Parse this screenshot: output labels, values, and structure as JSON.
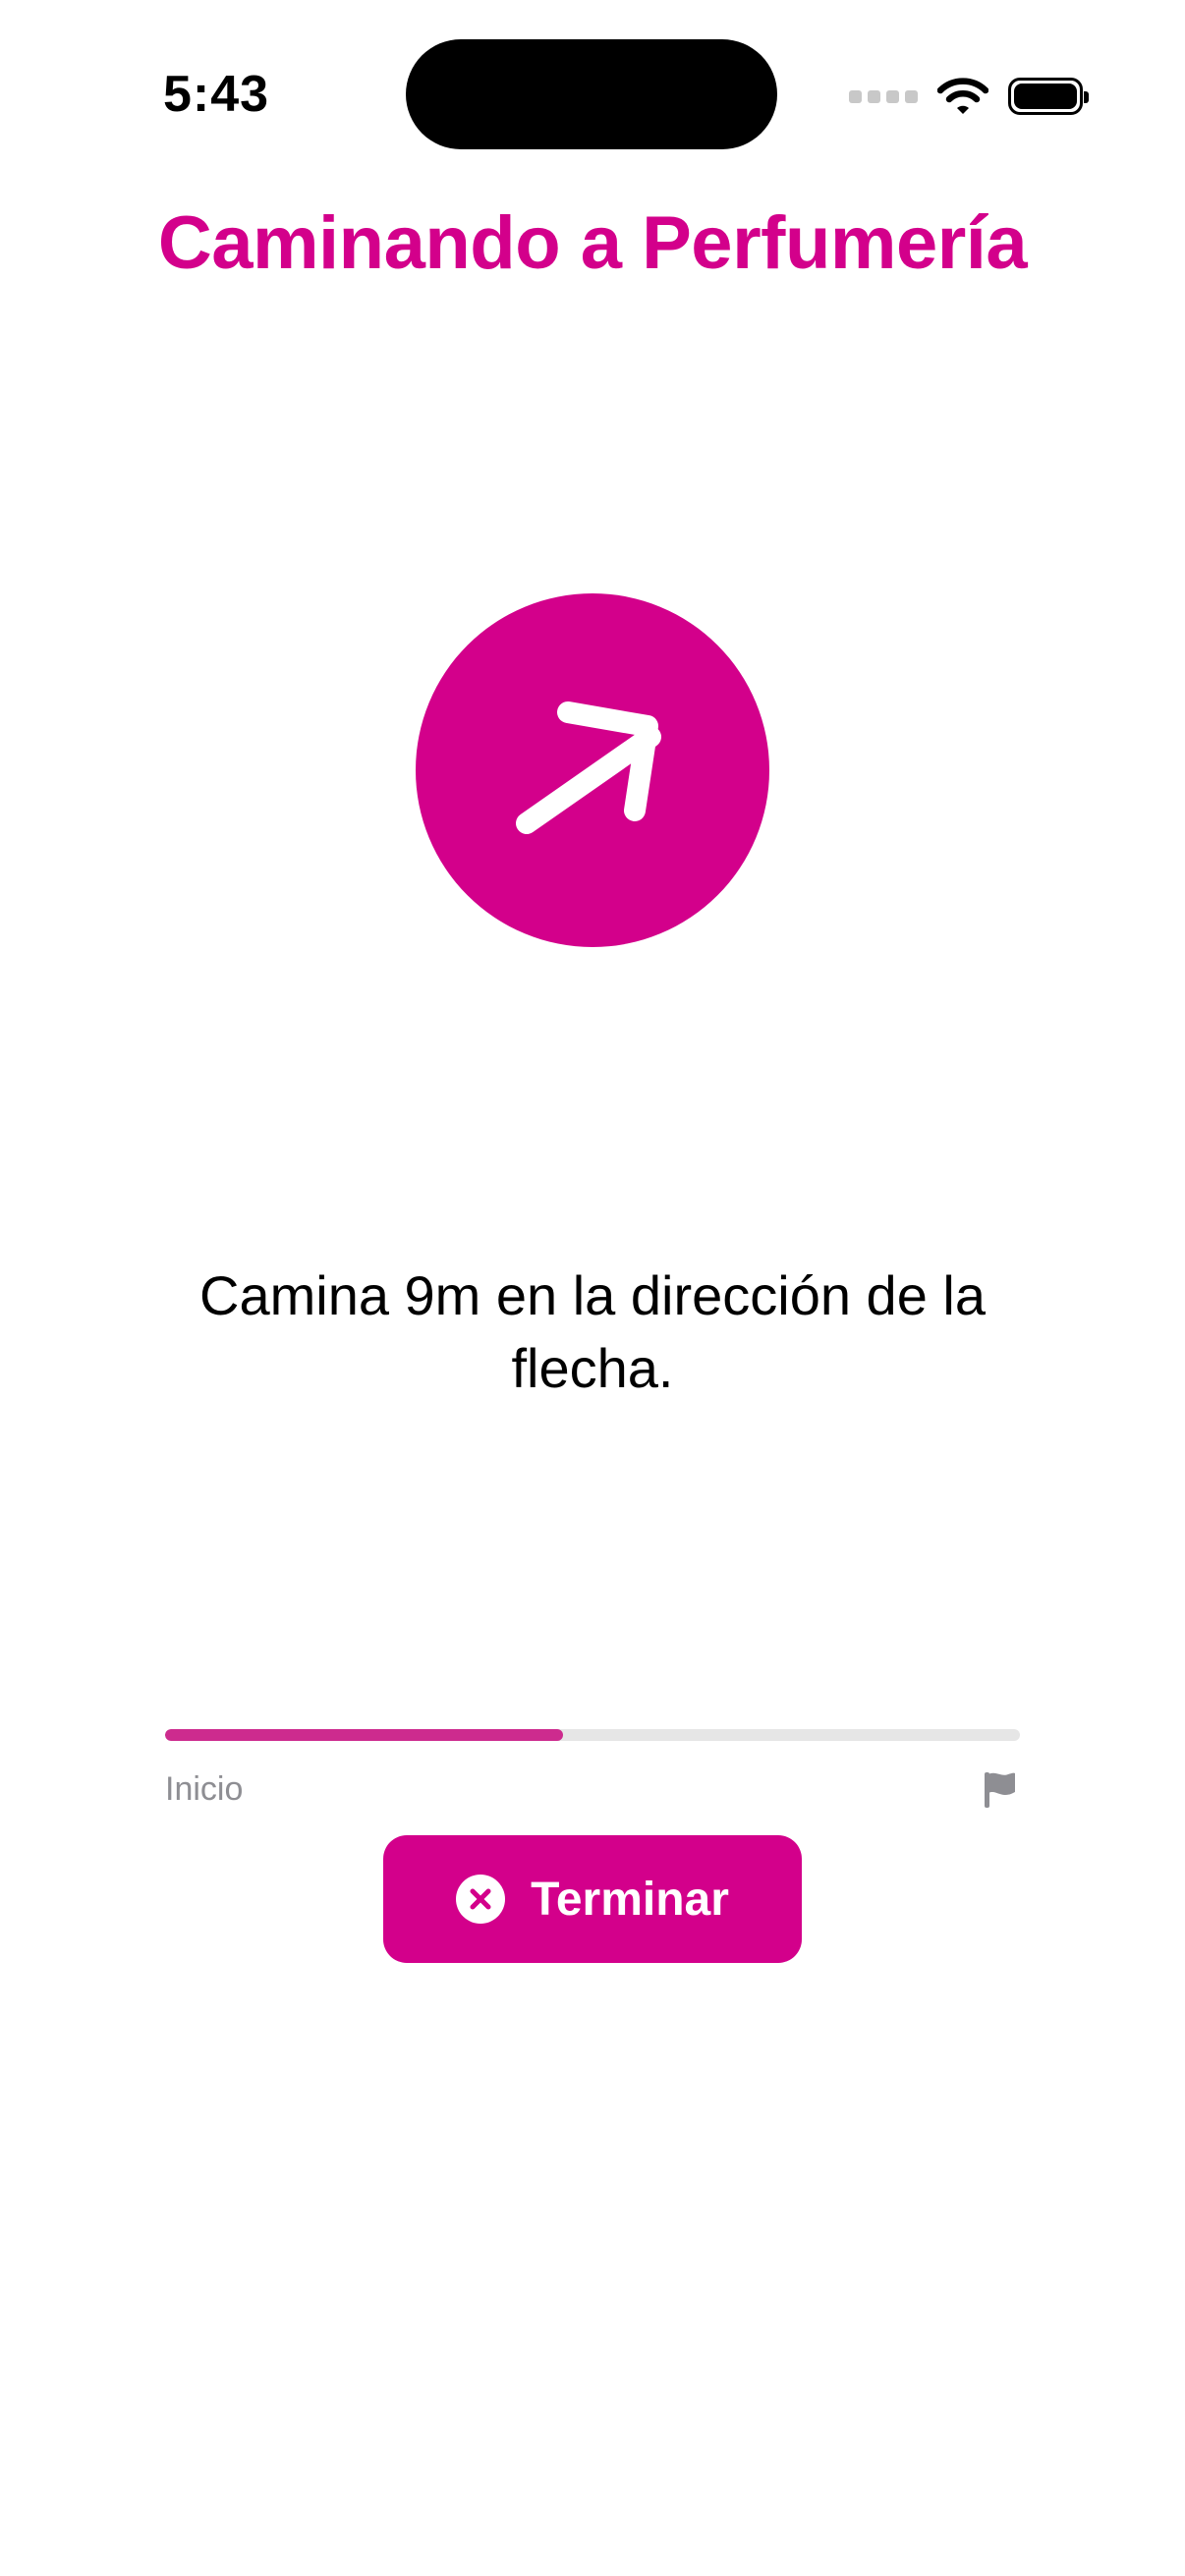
{
  "status_bar": {
    "time": "5:43",
    "icons": [
      "cellular-signal-icon",
      "wifi-icon",
      "battery-icon"
    ]
  },
  "header": {
    "title": "Caminando a Perfumería"
  },
  "direction": {
    "icon": "arrow-up-right-icon",
    "instruction": "Camina 9m en la dirección de la flecha."
  },
  "progress": {
    "value": 0.465,
    "start_label": "Inicio",
    "end_icon": "flag-icon"
  },
  "actions": {
    "finish_label": "Terminar",
    "finish_icon": "xmark-circle-icon"
  },
  "colors": {
    "accent": "#d3008b",
    "progress_fill": "#cd2b8e",
    "progress_track": "#e6e6e6",
    "secondary_text": "#8e8e93"
  }
}
